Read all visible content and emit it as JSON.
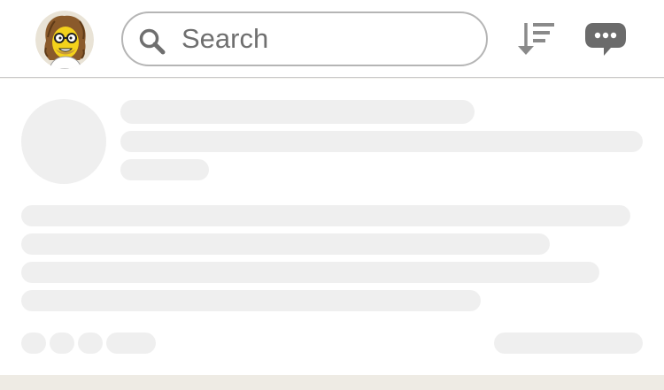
{
  "header": {
    "avatar": {
      "icon": "cartoon-avatar"
    },
    "search": {
      "placeholder": "Search",
      "value": "",
      "icon": "search-icon"
    },
    "sort_button": {
      "icon": "sort-descending-icon"
    },
    "messages_button": {
      "icon": "chat-bubble-icon"
    }
  },
  "feed": {
    "state": "loading",
    "placeholder_color": "#efefef"
  },
  "colors": {
    "page_background": "#ffffff",
    "header_border": "#c9c9c9",
    "icon_gray": "#7a7a7a",
    "chat_icon": "#6b6b6b",
    "bottom_strip": "#eeebe4"
  }
}
